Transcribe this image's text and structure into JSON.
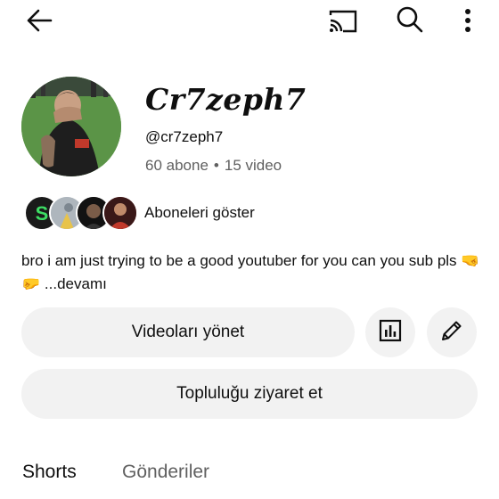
{
  "header": {
    "back_icon": "arrow-left-icon",
    "cast_icon": "cast-icon",
    "search_icon": "search-icon",
    "more_icon": "more-vertical-icon"
  },
  "channel": {
    "name": "Cr7zeph7",
    "handle": "@cr7zeph7",
    "subscribers": "60 abone",
    "separator": "•",
    "videos": "15 video",
    "show_subscribers": "Aboneleri göster",
    "description": "bro i am just trying to be a good youtuber for you can you sub pls",
    "description_emoji": "🤜🤛",
    "more_label": "...devamı"
  },
  "actions": {
    "manage_videos": "Videoları yönet",
    "analytics_icon": "bar-chart-icon",
    "edit_icon": "pencil-icon",
    "visit_community": "Topluluğu ziyaret et"
  },
  "tabs": [
    {
      "label": "Shorts"
    },
    {
      "label": "Gönderiler"
    }
  ],
  "colors": {
    "background": "#ffffff",
    "text": "#0f0f0f",
    "secondary_text": "#606060",
    "button_bg": "#f2f2f2"
  }
}
